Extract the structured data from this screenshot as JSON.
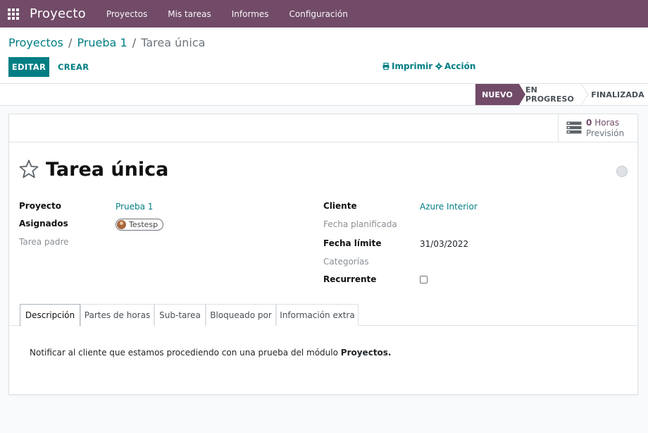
{
  "navbar": {
    "brand": "Proyecto",
    "menu": [
      "Proyectos",
      "Mis tareas",
      "Informes",
      "Configuración"
    ],
    "background": "#714b67"
  },
  "breadcrumb": {
    "items": [
      "Proyectos",
      "Prueba 1"
    ],
    "separator": "/",
    "current": "Tarea única"
  },
  "toolbar": {
    "edit_label": "EDITAR",
    "create_label": "CREAR",
    "print_label": "Imprimir",
    "action_label": "Acción",
    "accent": "#017e84"
  },
  "statusbar": {
    "stages": [
      "NUEVO",
      "EN PROGRESO",
      "FINALIZADA"
    ],
    "current_stage": "NUEVO"
  },
  "stat_button": {
    "value": "0",
    "unit": "Horas",
    "label": "Previsión",
    "icon": "server-icon"
  },
  "task": {
    "title": "Tarea única",
    "favorite_icon": "star-outline-icon",
    "kanban_state_icon": "circle-status-icon"
  },
  "fields_left": {
    "project_label": "Proyecto",
    "project_value": "Prueba 1",
    "assignees_label": "Asignados",
    "assignee_tag": "Testesp",
    "parent_label": "Tarea padre"
  },
  "fields_right": {
    "customer_label": "Cliente",
    "customer_value": "Azure Interior",
    "planned_date_label": "Fecha planificada",
    "deadline_label": "Fecha límite",
    "deadline_value": "31/03/2022",
    "tags_label": "Categorías",
    "recurrent_label": "Recurrente",
    "recurrent_checked": false
  },
  "tabs": [
    "Descripción",
    "Partes de horas",
    "Sub-tarea",
    "Bloqueado por",
    "Información extra"
  ],
  "active_tab": "Descripción",
  "description": {
    "text": "Notificar al cliente que estamos procediendo con una prueba del módulo",
    "bold": "Proyectos."
  }
}
